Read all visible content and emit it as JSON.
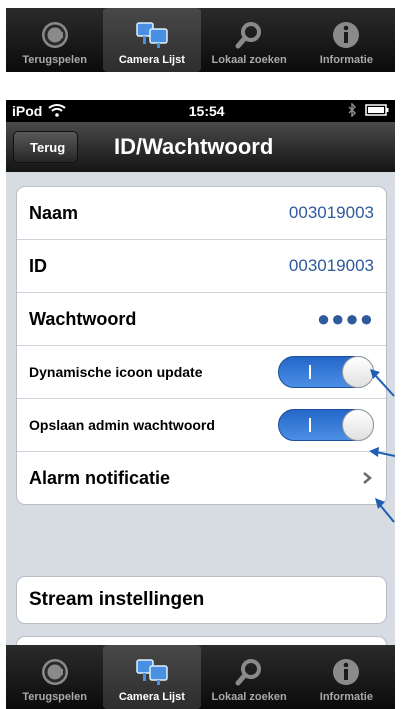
{
  "tabbar_top": {
    "tabs": [
      {
        "label": "Terugspelen",
        "icon": "replay-icon",
        "active": false
      },
      {
        "label": "Camera Lijst",
        "icon": "camera-list-icon",
        "active": true
      },
      {
        "label": "Lokaal zoeken",
        "icon": "search-icon",
        "active": false
      },
      {
        "label": "Informatie",
        "icon": "info-icon",
        "active": false
      }
    ]
  },
  "statusbar": {
    "device": "iPod",
    "time": "15:54",
    "wifi": "wifi-icon",
    "bluetooth": "bluetooth-icon",
    "battery": "battery-icon"
  },
  "navbar": {
    "back_label": "Terug",
    "title": "ID/Wachtwoord"
  },
  "settings": {
    "naam": {
      "label": "Naam",
      "value": "003019003"
    },
    "id": {
      "label": "ID",
      "value": "003019003"
    },
    "wachtwoord": {
      "label": "Wachtwoord",
      "value": "●●●●"
    },
    "dynamische": {
      "label": "Dynamische icoon update",
      "state": "on"
    },
    "opslaan": {
      "label": "Opslaan admin wachtwoord",
      "state": "on"
    },
    "alarm": {
      "label": "Alarm notificatie"
    }
  },
  "stream": {
    "label": "Stream instellingen"
  },
  "tabbar_bottom": {
    "tabs": [
      {
        "label": "Terugspelen",
        "icon": "replay-icon",
        "active": false
      },
      {
        "label": "Camera Lijst",
        "icon": "camera-list-icon",
        "active": true
      },
      {
        "label": "Lokaal zoeken",
        "icon": "search-icon",
        "active": false
      },
      {
        "label": "Informatie",
        "icon": "info-icon",
        "active": false
      }
    ]
  },
  "colors": {
    "accent": "#2f5b9c",
    "toggle": "#2f77d8",
    "arrow": "#1f5fb3"
  }
}
